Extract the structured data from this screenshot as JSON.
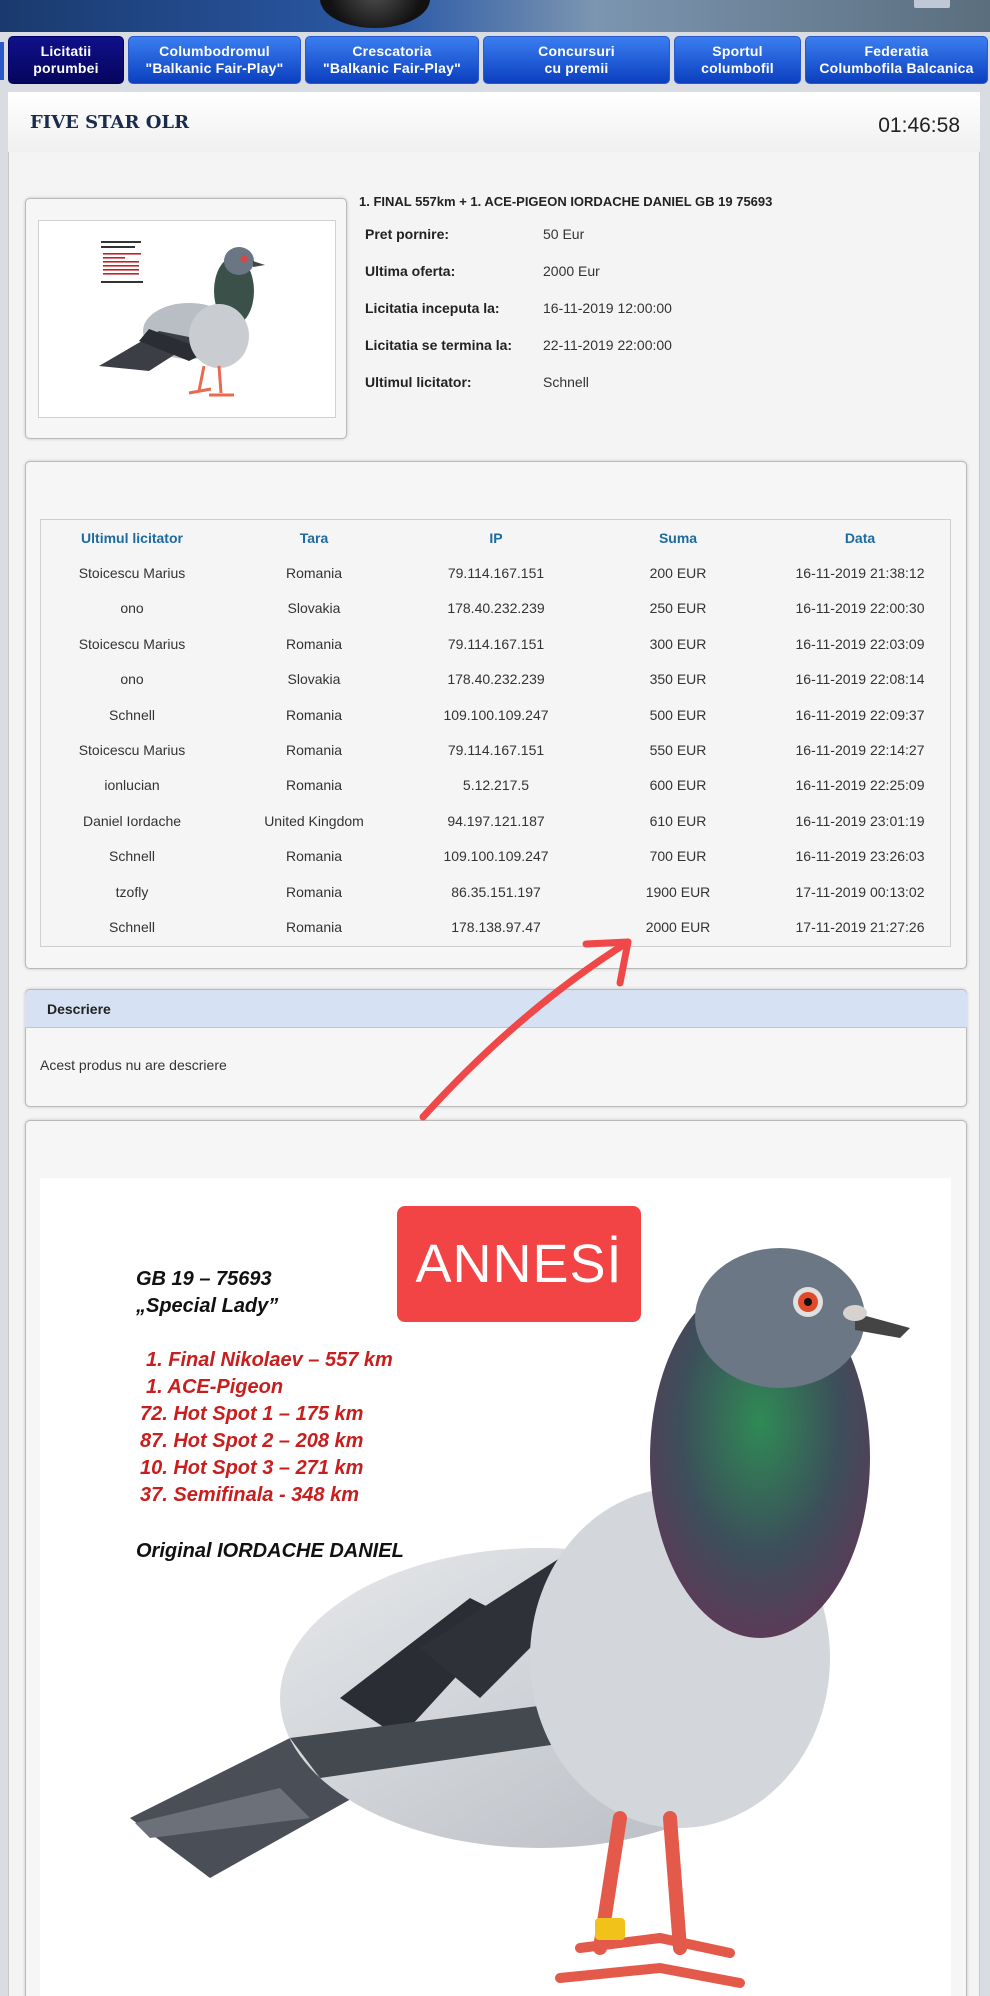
{
  "nav": {
    "items": [
      {
        "line1": "Licitatii",
        "line2": "porumbei"
      },
      {
        "line1": "Columbodromul",
        "line2": "\"Balkanic Fair-Play\""
      },
      {
        "line1": "Crescatoria",
        "line2": "\"Balkanic Fair-Play\""
      },
      {
        "line1": "Concursuri",
        "line2": "cu premii"
      },
      {
        "line1": "Sportul",
        "line2": "columbofil"
      },
      {
        "line1": "Federatia",
        "line2": "Columbofila Balcanica"
      }
    ]
  },
  "header": {
    "title": "FIVE STAR OLR",
    "clock": "01:46:58"
  },
  "product": {
    "title": "1. FINAL 557km + 1. ACE-PIGEON IORDACHE DANIEL GB 19 75693",
    "fields": [
      {
        "label": "Pret pornire:",
        "value": "50 Eur"
      },
      {
        "label": "Ultima oferta:",
        "value": "2000 Eur"
      },
      {
        "label": "Licitatia inceputa la:",
        "value": "16-11-2019 12:00:00"
      },
      {
        "label": "Licitatia se termina la:",
        "value": "22-11-2019 22:00:00"
      },
      {
        "label": "Ultimul licitator:",
        "value": "Schnell"
      }
    ]
  },
  "bids": {
    "columns": [
      "Ultimul licitator",
      "Tara",
      "IP",
      "Suma",
      "Data"
    ],
    "rows": [
      [
        "Stoicescu Marius",
        "Romania",
        "79.114.167.151",
        "200 EUR",
        "16-11-2019 21:38:12"
      ],
      [
        "ono",
        "Slovakia",
        "178.40.232.239",
        "250 EUR",
        "16-11-2019 22:00:30"
      ],
      [
        "Stoicescu Marius",
        "Romania",
        "79.114.167.151",
        "300 EUR",
        "16-11-2019 22:03:09"
      ],
      [
        "ono",
        "Slovakia",
        "178.40.232.239",
        "350 EUR",
        "16-11-2019 22:08:14"
      ],
      [
        "Schnell",
        "Romania",
        "109.100.109.247",
        "500 EUR",
        "16-11-2019 22:09:37"
      ],
      [
        "Stoicescu Marius",
        "Romania",
        "79.114.167.151",
        "550 EUR",
        "16-11-2019 22:14:27"
      ],
      [
        "ionlucian",
        "Romania",
        "5.12.217.5",
        "600 EUR",
        "16-11-2019 22:25:09"
      ],
      [
        "Daniel Iordache",
        "United Kingdom",
        "94.197.121.187",
        "610 EUR",
        "16-11-2019 23:01:19"
      ],
      [
        "Schnell",
        "Romania",
        "109.100.109.247",
        "700 EUR",
        "16-11-2019 23:26:03"
      ],
      [
        "tzofly",
        "Romania",
        "86.35.151.197",
        "1900 EUR",
        "17-11-2019 00:13:02"
      ],
      [
        "Schnell",
        "Romania",
        "178.138.97.47",
        "2000 EUR",
        "17-11-2019 21:27:26"
      ]
    ]
  },
  "description": {
    "heading": "Descriere",
    "text": "Acest produs nu are descriere"
  },
  "annotation": {
    "tag": "ANNESİ",
    "arrow_color": "#f04848"
  },
  "pigeon_image": {
    "ring": "GB   19 – 75693",
    "name": "„Special Lady”",
    "results": [
      "1.  Final Nikolaev – 557 km",
      "1.  ACE-Pigeon",
      "72. Hot Spot 1 – 175 km",
      "87. Hot Spot 2 – 208 km",
      "10. Hot Spot 3 – 271 km",
      "37. Semifinala  - 348 km"
    ],
    "owner": "Original  IORDACHE DANIEL"
  },
  "colors": {
    "nav_blue": "#1a55d8",
    "nav_active": "#0a0a70",
    "table_header": "#1c6aa0",
    "results_red": "#c81e1e"
  }
}
